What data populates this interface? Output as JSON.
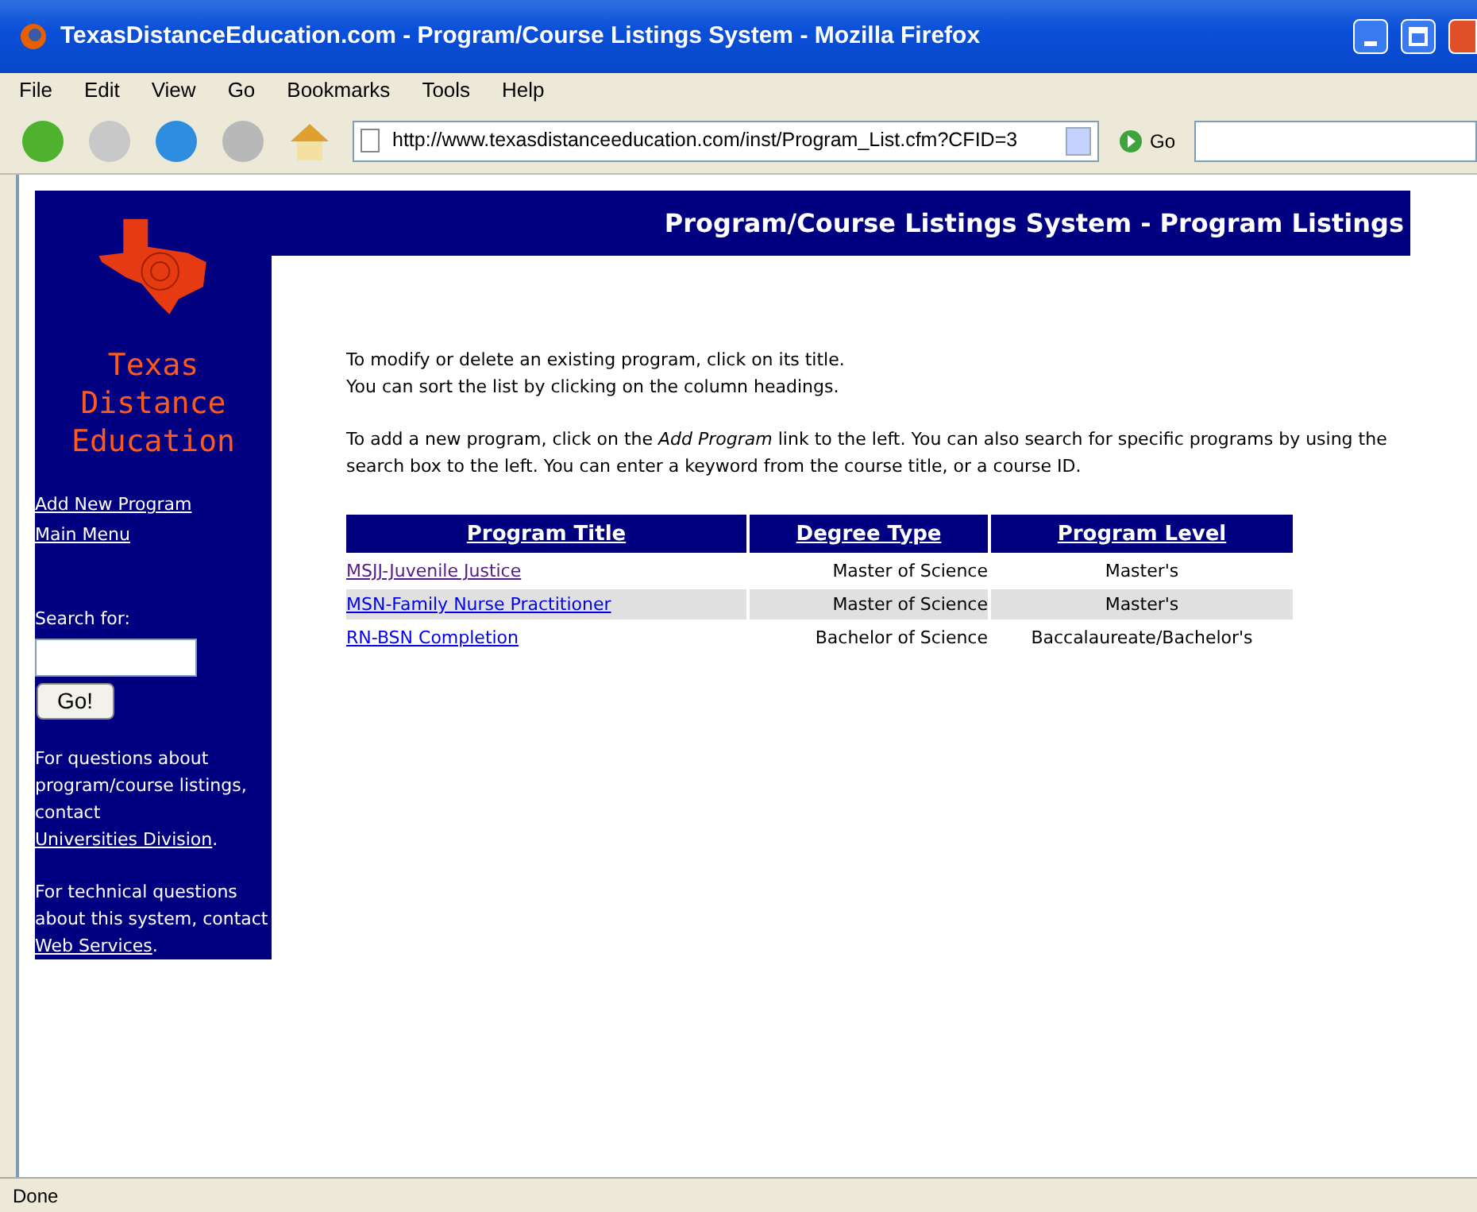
{
  "window": {
    "title": "TexasDistanceEducation.com - Program/Course Listings System - Mozilla Firefox"
  },
  "menu": [
    "File",
    "Edit",
    "View",
    "Go",
    "Bookmarks",
    "Tools",
    "Help"
  ],
  "toolbar": {
    "url": "http://www.texasdistanceeducation.com/inst/Program_List.cfm?CFID=3",
    "go": "Go"
  },
  "sidebar": {
    "logo_lines": [
      "Texas",
      "Distance",
      "Education"
    ],
    "links": [
      "Add New Program",
      "Main Menu"
    ],
    "search_label": "Search for:",
    "search_button": "Go!",
    "help": [
      {
        "text": "For questions about program/course listings, contact",
        "link": "Universities Division",
        "after": "."
      },
      {
        "text": "For technical questions about this system, contact",
        "link": "Web Services",
        "after": "."
      }
    ]
  },
  "header": "Program/Course Listings System - Program Listings",
  "intro": [
    "To modify or delete an existing program, click on its title.",
    "You can sort the list by clicking on the column headings."
  ],
  "intro2": "To add a new program, click on the *Add Program* link to the left. You can also search for specific programs by using the search box to the left. You can enter a keyword from the course title, or a course ID.",
  "table": {
    "columns": [
      "Program Title",
      "Degree Type",
      "Program Level"
    ],
    "rows": [
      {
        "title": "MSJJ-Juvenile Justice",
        "visited": true,
        "degree": "Master of Science",
        "level": "Master's"
      },
      {
        "title": "MSN-Family Nurse Practitioner",
        "visited": false,
        "degree": "Master of Science",
        "level": "Master's"
      },
      {
        "title": "RN-BSN Completion",
        "visited": false,
        "degree": "Bachelor of Science",
        "level": "Baccalaureate/Bachelor's"
      }
    ]
  },
  "status_bar": "Done"
}
